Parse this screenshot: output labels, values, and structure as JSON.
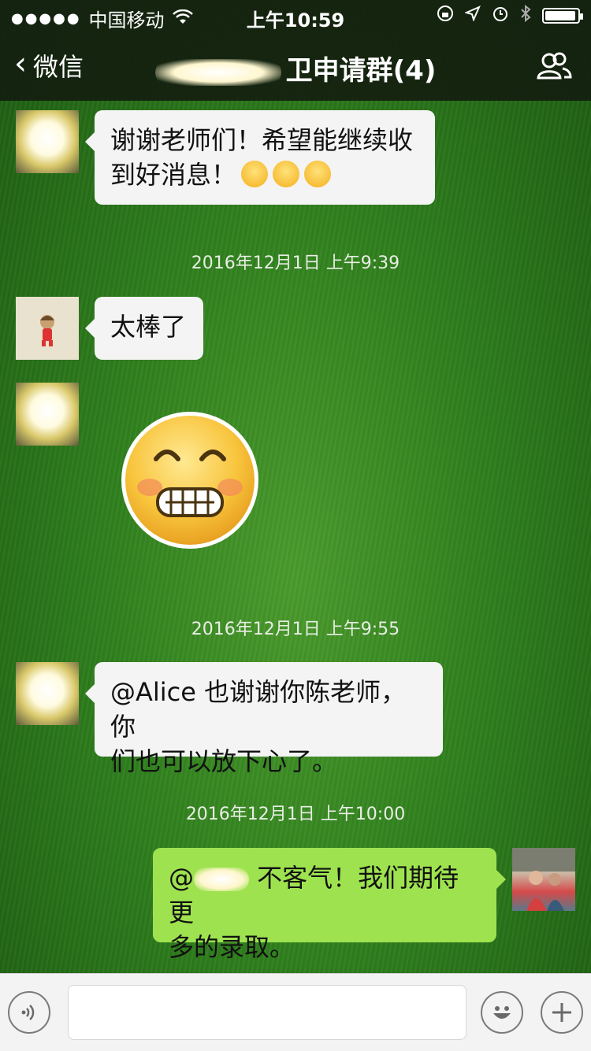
{
  "status_bar": {
    "signal": "●●●●●",
    "carrier": "中国移动",
    "time": "上午10:59"
  },
  "nav": {
    "back_label": "微信",
    "title_suffix": "卫申请群(4)"
  },
  "messages": [
    {
      "text_a": "谢谢老师们！希望能继续收",
      "text_b": "到好消息！"
    },
    {
      "text": "太棒了"
    },
    {
      "text_a": "@Alice 也谢谢你陈老师，你",
      "text_b": "们也可以放下心了。"
    },
    {
      "text_prefix": "@",
      "text_a": " 不客气！我们期待更",
      "text_b": "多的录取。"
    }
  ],
  "timestamps": [
    "2016年12月1日 上午9:39",
    "2016年12月1日 上午9:55",
    "2016年12月1日 上午10:00"
  ],
  "colors": {
    "bubble_other": "#f4f4f4",
    "bubble_mine": "#9ee34f",
    "bar": "#141e0f"
  },
  "icons": {
    "group": "group-icon",
    "voice": "voice-icon",
    "emoji": "emoji-icon",
    "plus": "plus-icon"
  },
  "battery_level": 0.95
}
